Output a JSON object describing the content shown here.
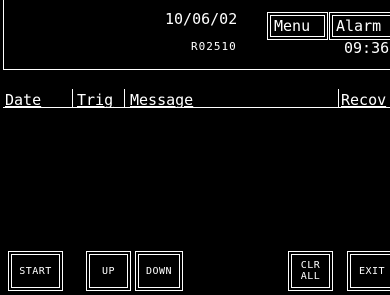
{
  "header": {
    "date": "10/06/02",
    "code": "R02510",
    "time": "09:36",
    "menu_label": "Menu",
    "alarm_label": "Alarm"
  },
  "columns": {
    "date": "Date",
    "trig": "Trig",
    "message": "Message",
    "recovered": "Recov"
  },
  "softkeys": {
    "start": "START",
    "up": "UP",
    "down": "DOWN",
    "clear_all": "CLR\nALL",
    "exit": "EXIT"
  }
}
